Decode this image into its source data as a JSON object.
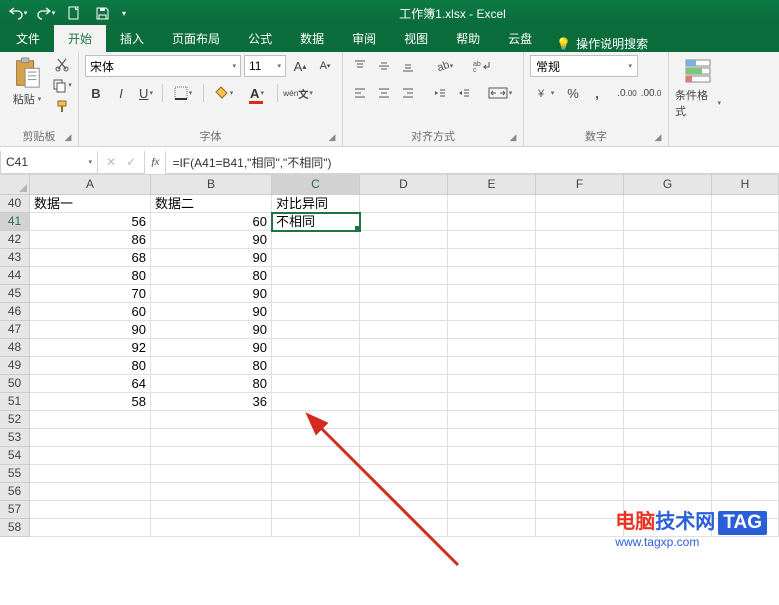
{
  "title": "工作簿1.xlsx  -  Excel",
  "tabs": {
    "file": "文件",
    "home": "开始",
    "insert": "插入",
    "page_layout": "页面布局",
    "formulas": "公式",
    "data": "数据",
    "review": "审阅",
    "view": "视图",
    "help": "帮助",
    "cloud": "云盘",
    "tell_me": "操作说明搜索"
  },
  "ribbon": {
    "clipboard": {
      "paste": "粘贴",
      "label": "剪贴板"
    },
    "font": {
      "name": "宋体",
      "size": "11",
      "label": "字体"
    },
    "alignment": {
      "label": "对齐方式"
    },
    "number": {
      "format": "常规",
      "label": "数字"
    },
    "cond": {
      "label": "条件格式"
    }
  },
  "namebox": "C41",
  "formula": "=IF(A41=B41,\"相同\",\"不相同\")",
  "cols": [
    "A",
    "B",
    "C",
    "D",
    "E",
    "F",
    "G",
    "H"
  ],
  "rows": [
    40,
    41,
    42,
    43,
    44,
    45,
    46,
    47,
    48,
    49,
    50,
    51,
    52,
    53,
    54,
    55,
    56,
    57,
    58
  ],
  "selected": {
    "row": 41,
    "col": "C"
  },
  "grid": {
    "40": {
      "A": "数据一",
      "B": "数据二",
      "C": "对比异同"
    },
    "41": {
      "A": "56",
      "B": "60",
      "C": "不相同"
    },
    "42": {
      "A": "86",
      "B": "90"
    },
    "43": {
      "A": "68",
      "B": "90"
    },
    "44": {
      "A": "80",
      "B": "80"
    },
    "45": {
      "A": "70",
      "B": "90"
    },
    "46": {
      "A": "60",
      "B": "90"
    },
    "47": {
      "A": "90",
      "B": "90"
    },
    "48": {
      "A": "92",
      "B": "90"
    },
    "49": {
      "A": "80",
      "B": "80"
    },
    "50": {
      "A": "64",
      "B": "80"
    },
    "51": {
      "A": "58",
      "B": "36"
    }
  },
  "text_cells": [
    "40-A",
    "40-B",
    "40-C",
    "41-C"
  ],
  "watermark": {
    "brand_a": "电脑",
    "brand_b": "技术网",
    "tag": "TAG",
    "url": "www.tagxp.com"
  }
}
